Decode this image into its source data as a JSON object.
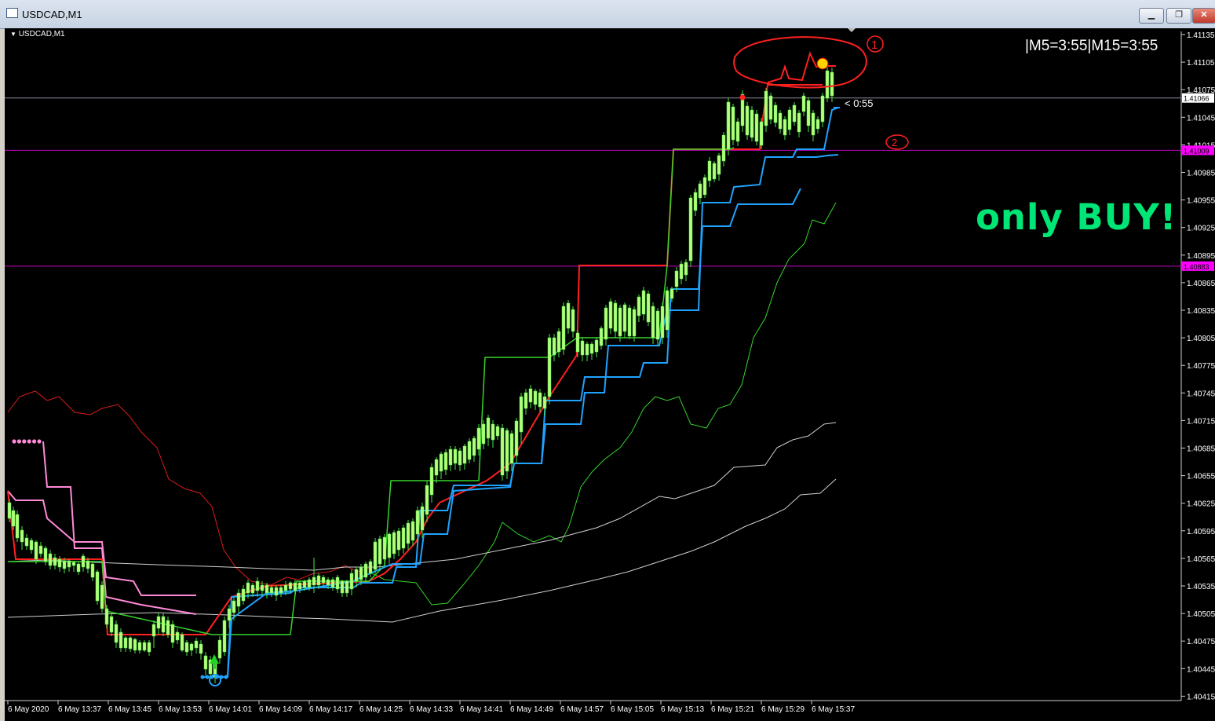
{
  "window": {
    "title": "USDCAD,M1"
  },
  "chart_data": {
    "type": "candlestick",
    "symbol_label": "USDCAD,M1",
    "timer_text": "|M5=3:55|M15=3:55",
    "annotation_text": "only BUY!",
    "countdown_text": "< 0:55",
    "marks": [
      "1",
      "2"
    ],
    "price_ticks": [
      "1.41135",
      "1.41105",
      "1.41075",
      "1.41045",
      "1.41015",
      "1.40985",
      "1.40955",
      "1.40925",
      "1.40895",
      "1.40865",
      "1.40835",
      "1.40805",
      "1.40775",
      "1.40745",
      "1.40715",
      "1.40685",
      "1.40655",
      "1.40625",
      "1.40595",
      "1.40565",
      "1.40535",
      "1.40505",
      "1.40475",
      "1.40445",
      "1.40415"
    ],
    "time_ticks": [
      "6 May 2020",
      "6 May 13:37",
      "6 May 13:45",
      "6 May 13:53",
      "6 May 14:01",
      "6 May 14:09",
      "6 May 14:17",
      "6 May 14:25",
      "6 May 14:33",
      "6 May 14:41",
      "6 May 14:49",
      "6 May 14:57",
      "6 May 15:05",
      "6 May 15:13",
      "6 May 15:21",
      "6 May 15:29",
      "6 May 15:37"
    ],
    "current_price": "1.41066",
    "levels": [
      {
        "price": 1.41009,
        "label": "1.41009",
        "color": "#ff00ff"
      },
      {
        "price": 1.40883,
        "label": "1.40883",
        "color": "#ff00ff"
      }
    ],
    "ylim": [
      1.40409,
      1.41141
    ],
    "colors": {
      "candle": "#b6ff7a",
      "wick": "#48e448",
      "red_line": "#ff2020",
      "blue_line": "#1fa3ff",
      "green_line": "#36d42a",
      "pink_line": "#ff8ad8",
      "gray": "#cfcfcf",
      "thin_red": "#d81b1b"
    }
  }
}
